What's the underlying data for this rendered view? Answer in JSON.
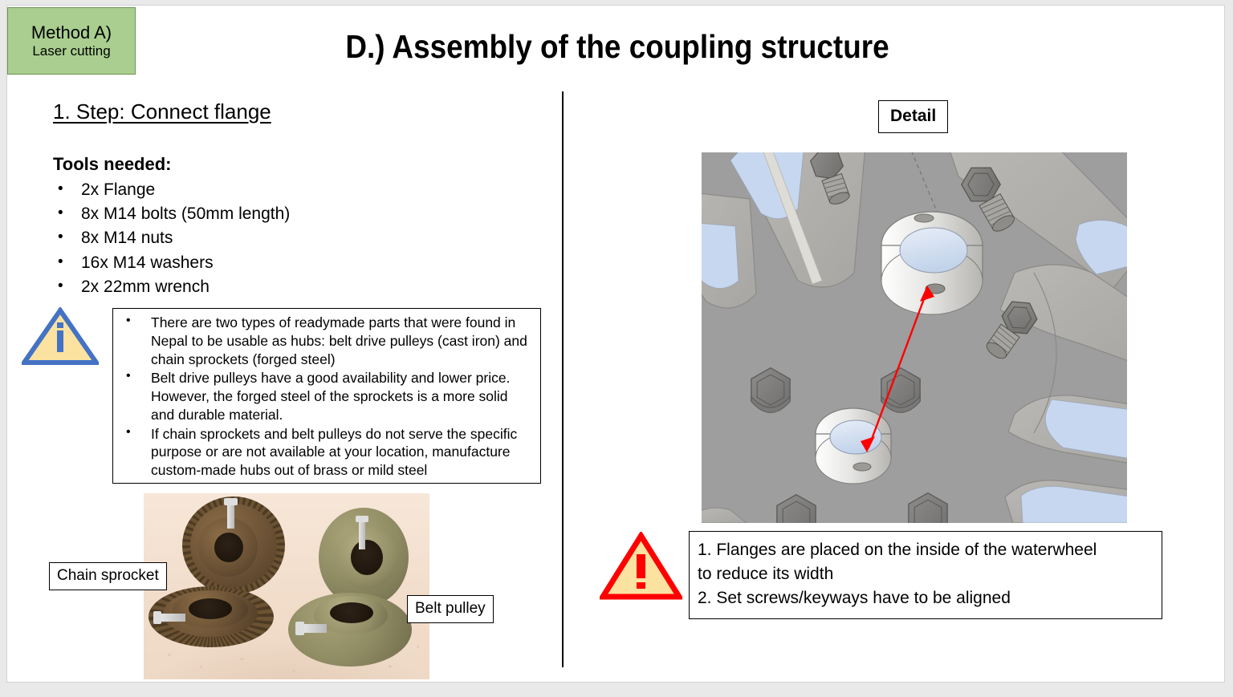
{
  "method_badge": {
    "line1": "Method A)",
    "line2": "Laser cutting",
    "fill_color": "#A9CE8F",
    "border_color": "#6F9455"
  },
  "title": "D.) Assembly of the coupling structure",
  "left": {
    "step_heading": "1. Step: Connect flange",
    "tools_heading": "Tools needed:",
    "tools": [
      "2x Flange",
      "8x M14 bolts (50mm length)",
      "8x M14 nuts",
      "16x M14 washers",
      "2x 22mm wrench"
    ],
    "info_icon": {
      "glyph": "i",
      "outline_color": "#4472C4",
      "fill_color": "#FBE2A0"
    },
    "info_bullets": [
      "There are two types of readymade parts that were found in Nepal to be usable as hubs: belt drive pulleys (cast iron) and chain sprockets (forged steel)",
      "Belt drive pulleys have a good availability and lower price. However, the forged steel of the sprockets is a more solid and durable material.",
      "If chain sprockets and belt pulleys do not serve the specific purpose or are not available at your location, manufacture custom-made hubs out of brass or mild steel"
    ],
    "photo_labels": {
      "left": "Chain sprocket",
      "right": "Belt pulley"
    }
  },
  "right": {
    "detail_label": "Detail",
    "cad": {
      "background_color": "#9E9E9E",
      "spoke_color": "#B3B1AE",
      "cutout_color": "#C9D8EE",
      "annotation_arrow_color": "#FF0000"
    },
    "warning_icon": {
      "glyph": "!",
      "outline_color": "#FF0000",
      "fill_color": "#FBE2A0"
    },
    "warning_lines": [
      "1. Flanges are placed on the inside of the waterwheel",
      "to reduce its width",
      "2. Set screws/keyways have to be aligned"
    ]
  }
}
